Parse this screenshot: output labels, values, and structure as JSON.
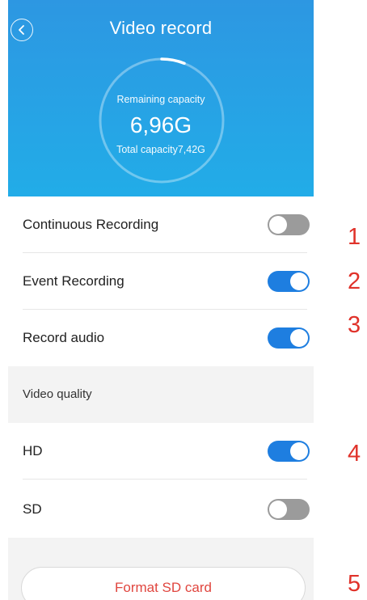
{
  "header": {
    "title": "Video record",
    "back_icon": "chevron-left-icon",
    "background_color": "#2aa0e6"
  },
  "capacity": {
    "remaining_label": "Remaining capacity",
    "remaining_value": "6,96G",
    "total_label": "Total capacity7,42G",
    "used_fraction": 0.06
  },
  "settings": {
    "continuous_recording": {
      "label": "Continuous Recording",
      "enabled": false
    },
    "event_recording": {
      "label": "Event Recording",
      "enabled": true
    },
    "record_audio": {
      "label": "Record audio",
      "enabled": true
    }
  },
  "quality": {
    "section_label": "Video quality",
    "hd": {
      "label": "HD",
      "enabled": true
    },
    "sd": {
      "label": "SD",
      "enabled": false
    }
  },
  "actions": {
    "format_label": "Format SD card"
  },
  "annotations": [
    "1",
    "2",
    "3",
    "4",
    "5"
  ],
  "colors": {
    "toggle_on": "#1e7ee0",
    "toggle_off": "#9b9b9b",
    "annotation": "#e0322a",
    "format_text": "#e0463f"
  }
}
